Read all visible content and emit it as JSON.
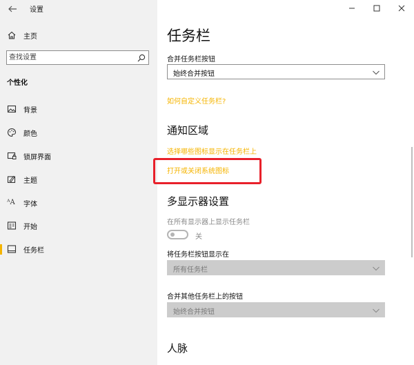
{
  "window": {
    "title": "设置",
    "minimize": "—",
    "maximize": "☐",
    "close": "✕"
  },
  "sidebar": {
    "home_label": "主页",
    "search_placeholder": "查找设置",
    "section": "个性化",
    "items": [
      {
        "label": "背景",
        "icon": "image-icon"
      },
      {
        "label": "颜色",
        "icon": "palette-icon"
      },
      {
        "label": "锁屏界面",
        "icon": "lock-screen-icon"
      },
      {
        "label": "主题",
        "icon": "theme-brush-icon"
      },
      {
        "label": "字体",
        "icon": "font-icon"
      },
      {
        "label": "开始",
        "icon": "start-menu-icon"
      },
      {
        "label": "任务栏",
        "icon": "taskbar-icon",
        "active": true
      }
    ],
    "accent_color": "#f5b400"
  },
  "main": {
    "title": "任务栏",
    "combine_label": "合并任务栏按钮",
    "combine_value": "始终合并按钮",
    "customize_link": "如何自定义任务栏?",
    "notification": {
      "title": "通知区域",
      "link_icons": "选择哪些图标显示在任务栏上",
      "link_system_icons": "打开或关闭系统图标"
    },
    "multi_display": {
      "title": "多显示器设置",
      "show_all_label": "在所有显示器上显示任务栏",
      "toggle_state": "关",
      "show_buttons_label": "将任务栏按钮显示在",
      "show_buttons_value": "所有任务栏",
      "combine_other_label": "合并其他任务栏上的按钮",
      "combine_other_value": "始终合并按钮"
    },
    "people_title": "人脉"
  },
  "colors": {
    "link": "#f5b400",
    "highlight": "#e8202a"
  }
}
